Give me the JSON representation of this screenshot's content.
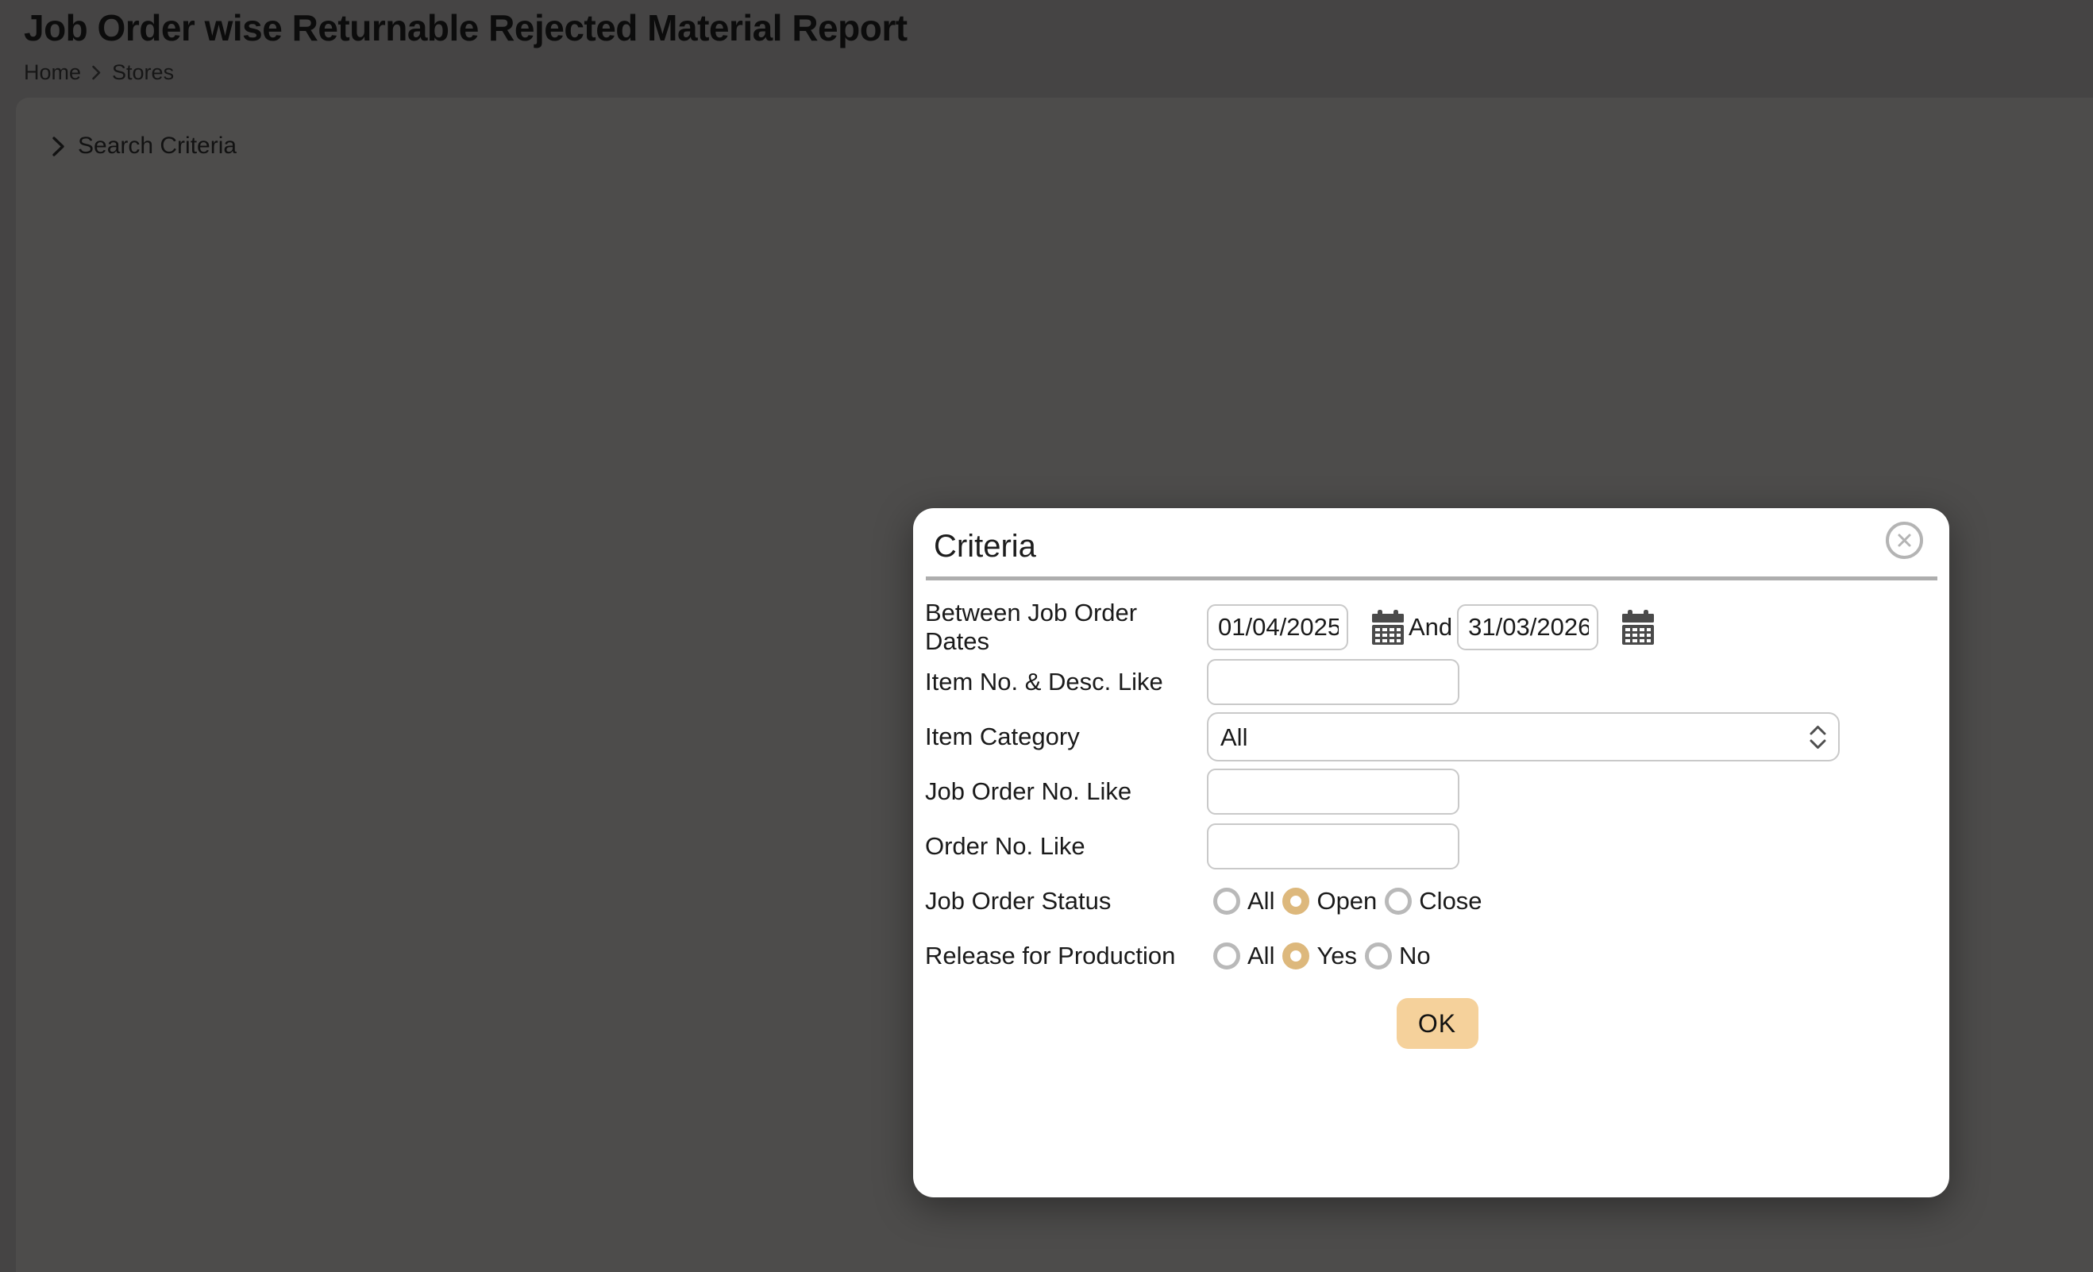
{
  "page": {
    "title": "Job Order wise Returnable Rejected Material Report"
  },
  "breadcrumb": {
    "home": "Home",
    "stores": "Stores"
  },
  "panel": {
    "search_criteria_label": "Search Criteria"
  },
  "modal": {
    "title": "Criteria",
    "date_row": {
      "label": "Between Job Order Dates",
      "from_value": "01/04/2025",
      "and_label": "And",
      "to_value": "31/03/2026"
    },
    "item_desc_row": {
      "label": "Item No. & Desc. Like",
      "value": ""
    },
    "item_category_row": {
      "label": "Item Category",
      "selected": "All"
    },
    "job_order_no_row": {
      "label": "Job Order No. Like",
      "value": ""
    },
    "order_no_row": {
      "label": "Order No. Like",
      "value": ""
    },
    "job_order_status_row": {
      "label": "Job Order Status",
      "options": [
        "All",
        "Open",
        "Close"
      ],
      "selected": "Open"
    },
    "release_row": {
      "label": "Release for Production",
      "options": [
        "All",
        "Yes",
        "No"
      ],
      "selected": "Yes"
    },
    "ok_label": "OK"
  },
  "icons": [
    "chevron-right-icon",
    "calendar-icon",
    "close-icon",
    "select-up-down-chevron-icon"
  ],
  "colors": {
    "page_bg": "#454444",
    "panel_bg": "#4d4c4b",
    "modal_bg": "#ffffff",
    "accent_selected": "#ddb87c",
    "ok_button": "#f5d19b",
    "border": "#c9c9c9",
    "icon_gray": "#4a4a4a",
    "muted_gray": "#b4b4b4"
  }
}
